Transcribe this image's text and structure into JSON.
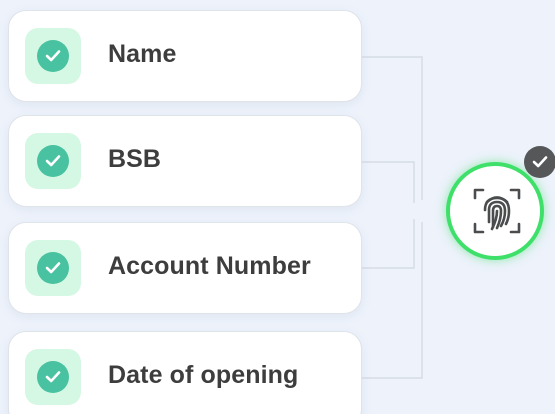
{
  "fields": [
    {
      "label": "Name",
      "status_icon": "check-icon",
      "verified": true
    },
    {
      "label": "BSB",
      "status_icon": "check-icon",
      "verified": true
    },
    {
      "label": "Account Number",
      "status_icon": "check-icon",
      "verified": true
    },
    {
      "label": "Date of opening",
      "status_icon": "check-icon",
      "verified": true
    }
  ],
  "biometric": {
    "icon": "fingerprint-icon",
    "badge_icon": "check-icon",
    "verified": true
  },
  "colors": {
    "background": "#edf2fb",
    "check_tile": "#d5f8e4",
    "check_circle": "#48c2a0",
    "connector_glow": "#3fe06a",
    "badge": "#555759",
    "label_text": "#3d3d3d"
  }
}
